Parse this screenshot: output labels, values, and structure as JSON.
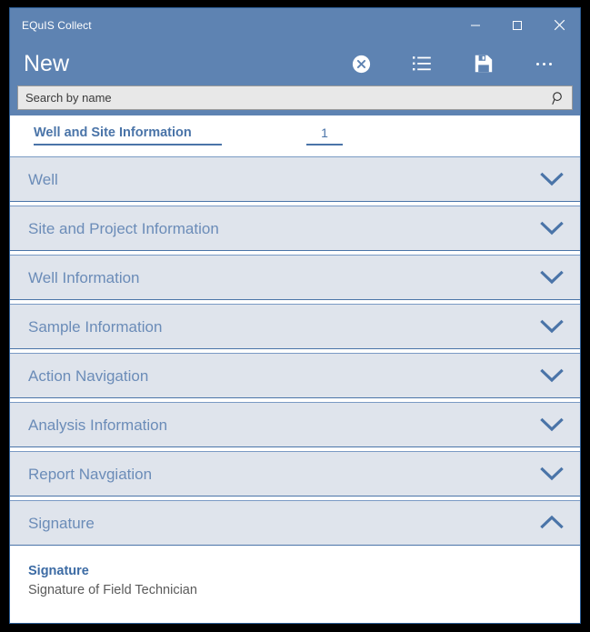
{
  "window": {
    "title": "EQuIS Collect",
    "controls": [
      {
        "name": "minimize",
        "glyph": "minimize-icon"
      },
      {
        "name": "maximize",
        "glyph": "maximize-icon"
      },
      {
        "name": "close",
        "glyph": "close-icon"
      }
    ]
  },
  "command_bar": {
    "page_title": "New",
    "actions": [
      {
        "name": "cancel",
        "icon": "cancel-circle-icon"
      },
      {
        "name": "list",
        "icon": "list-icon"
      },
      {
        "name": "save",
        "icon": "save-floppy-icon"
      },
      {
        "name": "more",
        "icon": "ellipsis-icon"
      }
    ]
  },
  "search": {
    "value": "",
    "placeholder": "Search by name",
    "icon": "search-icon"
  },
  "tabs": [
    {
      "label": "Well and Site Information",
      "selected": true
    },
    {
      "label": "1",
      "selected": true
    }
  ],
  "sections": [
    {
      "label": "Well",
      "expanded": false,
      "chevron": "chevron-down-icon"
    },
    {
      "label": "Site and Project Information",
      "expanded": false,
      "chevron": "chevron-down-icon"
    },
    {
      "label": "Well Information",
      "expanded": false,
      "chevron": "chevron-down-icon"
    },
    {
      "label": "Sample Information",
      "expanded": false,
      "chevron": "chevron-down-icon"
    },
    {
      "label": "Action Navigation",
      "expanded": false,
      "chevron": "chevron-down-icon"
    },
    {
      "label": "Analysis Information",
      "expanded": false,
      "chevron": "chevron-down-icon"
    },
    {
      "label": "Report Navgiation",
      "expanded": false,
      "chevron": "chevron-down-icon"
    },
    {
      "label": "Signature",
      "expanded": true,
      "chevron": "chevron-up-icon"
    }
  ],
  "signature_fields": [
    {
      "label": "Signature",
      "description": "Signature of Field Technician"
    }
  ],
  "colors": {
    "title_bar": "#5e83b2",
    "accent": "#4a74a8",
    "section_bg": "#dfe4ec",
    "section_title": "#6b8cb8",
    "field_label": "#3c6ba4",
    "field_sub": "#5a5a5a",
    "search_bg": "#e8e8e8",
    "frame": "#000000"
  }
}
